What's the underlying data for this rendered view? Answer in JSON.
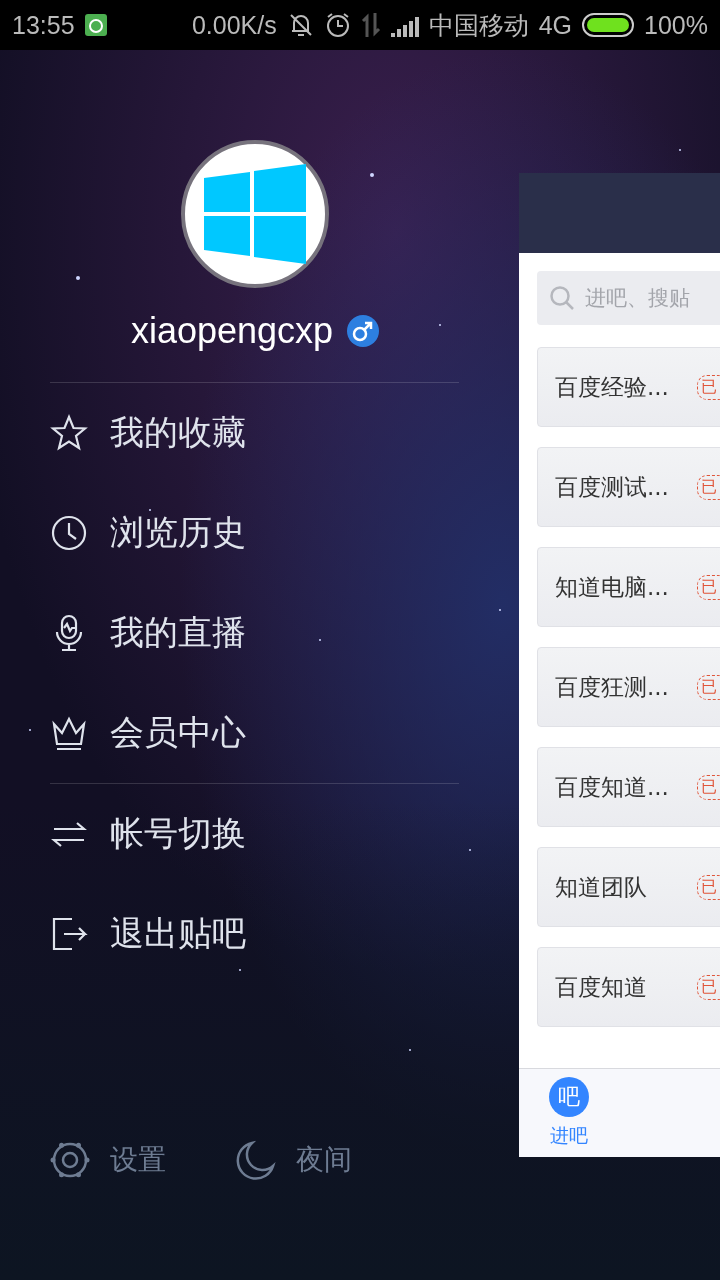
{
  "status_bar": {
    "time": "13:55",
    "speed": "0.00K/s",
    "carrier": "中国移动",
    "network": "4G",
    "battery": "100%"
  },
  "profile": {
    "username": "xiaopengcxp"
  },
  "menu_groups": [
    [
      {
        "kind": "star",
        "label": "我的收藏"
      },
      {
        "kind": "clock",
        "label": "浏览历史"
      },
      {
        "kind": "mic",
        "label": "我的直播"
      },
      {
        "kind": "crown",
        "label": "会员中心"
      }
    ],
    [
      {
        "kind": "swap",
        "label": "帐号切换"
      },
      {
        "kind": "exit",
        "label": "退出贴吧"
      }
    ]
  ],
  "footer": [
    {
      "kind": "settings",
      "label": "设置"
    },
    {
      "kind": "night",
      "label": "夜间"
    }
  ],
  "panel": {
    "search": {
      "placeholder": "进吧、搜贴"
    },
    "forums": [
      {
        "name": "百度经验...",
        "badge": "已"
      },
      {
        "name": "百度测试...",
        "badge": "已"
      },
      {
        "name": "知道电脑...",
        "badge": "已"
      },
      {
        "name": "百度狂测...",
        "badge": "已"
      },
      {
        "name": "百度知道...",
        "badge": "已"
      },
      {
        "name": "知道团队",
        "badge": "已"
      },
      {
        "name": "百度知道",
        "badge": "已"
      }
    ],
    "tabs": [
      {
        "icon": "吧",
        "label": "进吧",
        "selected": true
      }
    ]
  }
}
